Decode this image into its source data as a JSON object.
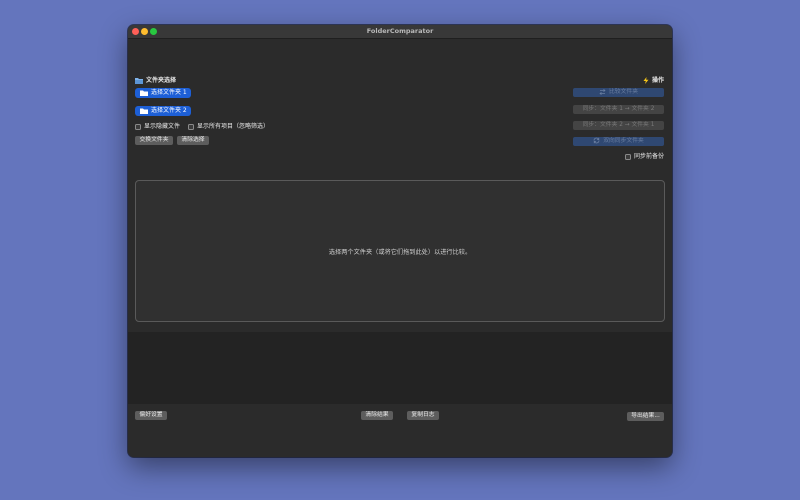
{
  "window": {
    "title": "FolderComparator"
  },
  "selection": {
    "heading": "文件夹选择",
    "folder1_label": "选择文件夹 1",
    "folder2_label": "选择文件夹 2",
    "show_hidden_label": "显示隐藏文件",
    "show_all_label": "显示所有项目（忽略筛选）",
    "swap_label": "交换文件夹",
    "clear_selection_label": "清除选择"
  },
  "actions": {
    "heading": "操作",
    "compare_label": "比较文件夹",
    "sync_1_to_2_label": "同步：文件夹 1 → 文件夹 2",
    "sync_2_to_1_label": "同步：文件夹 2 → 文件夹 1",
    "bidirectional_label": "双向同步文件夹",
    "backup_label": "同步前备份"
  },
  "main": {
    "placeholder": "选择两个文件夹（或将它们拖到此处）以进行比较。"
  },
  "footer": {
    "preferences_label": "偏好设置",
    "clear_results_label": "清除结果",
    "copy_log_label": "复制日志",
    "export_label": "导出结果..."
  },
  "colors": {
    "background": "#6475bd",
    "accent": "#1d5fd6",
    "window": "#2b2b2b"
  },
  "icons": {
    "selection_heading": "folder-icon",
    "actions_heading": "lightning-icon",
    "folder_button": "folder-icon",
    "compare_button": "arrows-swap-icon",
    "bidirectional_button": "refresh-icon"
  }
}
